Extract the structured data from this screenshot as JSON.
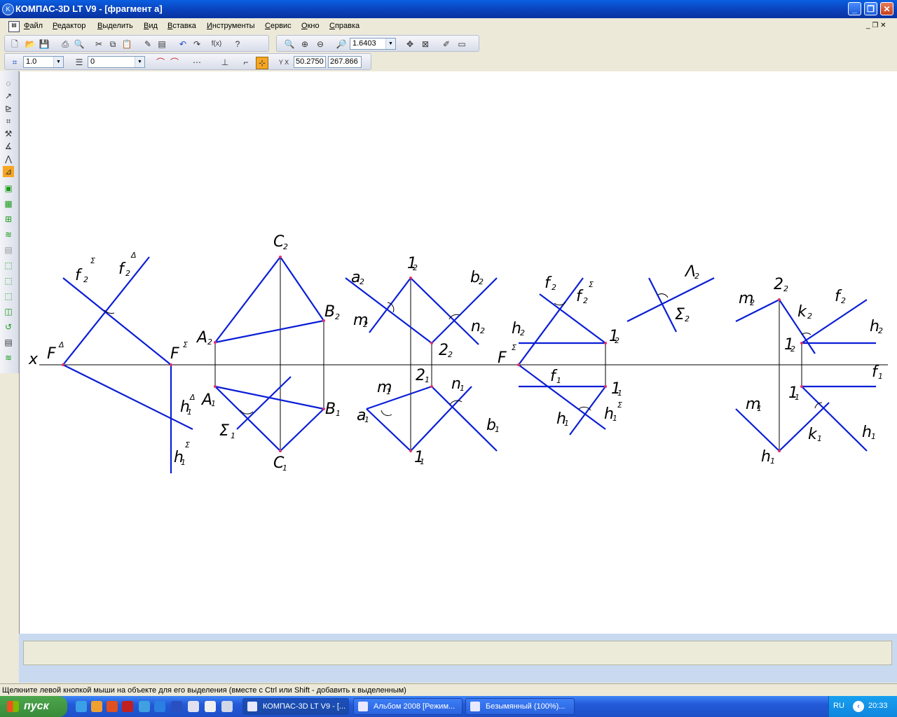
{
  "window": {
    "title": "КОМПАС-3D LT V9 - [фрагмент а]",
    "app_icon": "kompas-icon"
  },
  "menu": [
    "Файл",
    "Редактор",
    "Выделить",
    "Вид",
    "Вставка",
    "Инструменты",
    "Сервис",
    "Окно",
    "Справка"
  ],
  "toolbar": {
    "zoom_value": "1.6403",
    "line_scale": "1.0",
    "layer": "0",
    "coord_x": "50.2750",
    "coord_y": "267.866"
  },
  "drawing": {
    "x_axis": "x",
    "labels": {
      "f2S": "f",
      "f2D": "f",
      "FD": "F",
      "FS1": "F",
      "h1D": "h",
      "h1S": "h",
      "A2": "A",
      "A1": "A",
      "B2": "B",
      "B1": "B",
      "C2": "C",
      "C1": "C",
      "S1": "Σ",
      "a2": "a",
      "b2": "b",
      "m2": "m",
      "n2": "n",
      "one2": "1",
      "two2": "2",
      "two1": "2",
      "m1": "m",
      "n1": "n",
      "a1": "a",
      "b1": "b",
      "one1": "1",
      "f2b": "f",
      "f2Sb": "f",
      "h2": "h",
      "FS2": "F",
      "f1": "f",
      "one2b": "1",
      "one1b": "1",
      "h1b": "h",
      "h1Sb": "h",
      "L2": "Λ",
      "S2": "Σ",
      "m2c": "m",
      "two2c": "2",
      "k2": "k",
      "f2c": "f",
      "h2c": "h",
      "one2c": "1",
      "f1c": "f",
      "m1c": "m",
      "one1c": "1",
      "k1": "k",
      "h1c": "h",
      "h1d": "h"
    }
  },
  "status": "Щелкните левой кнопкой мыши на объекте для его выделения (вместе с Ctrl или Shift - добавить к выделенным)",
  "taskbar": {
    "start": "пуск",
    "tasks": [
      "КОМПАС-3D LT V9 - [...",
      "Альбом 2008 [Режим...",
      "Безымянный (100%)..."
    ],
    "lang": "RU",
    "clock": "20:33"
  },
  "colors": {
    "line": "#0a1ed6",
    "thin": "#000000",
    "point": "#e0306a"
  }
}
